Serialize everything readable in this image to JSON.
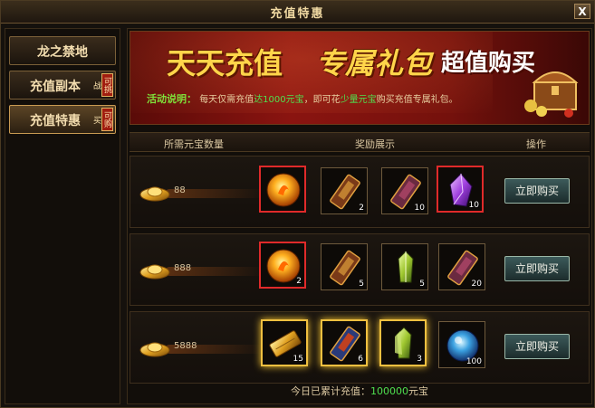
{
  "window": {
    "title": "充值特惠",
    "close_label": "X"
  },
  "sidebar": {
    "items": [
      {
        "label": "龙之禁地",
        "tag": "",
        "active": false
      },
      {
        "label": "充值副本",
        "tag": "可挑战",
        "active": false
      },
      {
        "label": "充值特惠",
        "tag": "可购买",
        "active": true
      }
    ]
  },
  "banner": {
    "title_part1": "天天充值",
    "title_part2": "专属礼包",
    "title_part3": "超值购买",
    "desc_label": "活动说明：",
    "desc_text1": "每天仅需充值",
    "desc_hl1": "达1000元宝",
    "desc_text2": "，即可花",
    "desc_hl2": "少量元宝",
    "desc_text3": "购买充值专属礼包。"
  },
  "table": {
    "headers": {
      "cost": "所需元宝数量",
      "rewards": "奖励展示",
      "action": "操作"
    },
    "rows": [
      {
        "cost": "88",
        "buy_label": "立即购买",
        "items": [
          {
            "icon": "fire-orb-icon",
            "qty": "",
            "frame": "red"
          },
          {
            "icon": "scroll-tablet-icon",
            "qty": "2",
            "frame": "normal"
          },
          {
            "icon": "scroll-tablet-icon",
            "qty": "10",
            "frame": "normal"
          },
          {
            "icon": "purple-crystal-icon",
            "qty": "10",
            "frame": "red"
          }
        ]
      },
      {
        "cost": "888",
        "buy_label": "立即购买",
        "items": [
          {
            "icon": "fire-orb-icon",
            "qty": "2",
            "frame": "red"
          },
          {
            "icon": "scroll-tablet-icon",
            "qty": "5",
            "frame": "normal"
          },
          {
            "icon": "green-crystal-icon",
            "qty": "5",
            "frame": "normal"
          },
          {
            "icon": "scroll-tablet-icon",
            "qty": "20",
            "frame": "normal"
          }
        ]
      },
      {
        "cost": "5888",
        "buy_label": "立即购买",
        "items": [
          {
            "icon": "gold-bar-icon",
            "qty": "15",
            "frame": "gold"
          },
          {
            "icon": "blue-tablet-icon",
            "qty": "6",
            "frame": "gold"
          },
          {
            "icon": "green-crystal-icon",
            "qty": "3",
            "frame": "gold"
          },
          {
            "icon": "blue-orb-icon",
            "qty": "100",
            "frame": "normal"
          }
        ]
      }
    ]
  },
  "footer": {
    "label": "今日已累计充值：",
    "amount": "100000",
    "unit": "元宝"
  },
  "colors": {
    "accent_gold": "#ffd54a",
    "highlight_green": "#4fe04f",
    "frame_red": "#e02a2a",
    "banner_red": "#8a1410"
  }
}
